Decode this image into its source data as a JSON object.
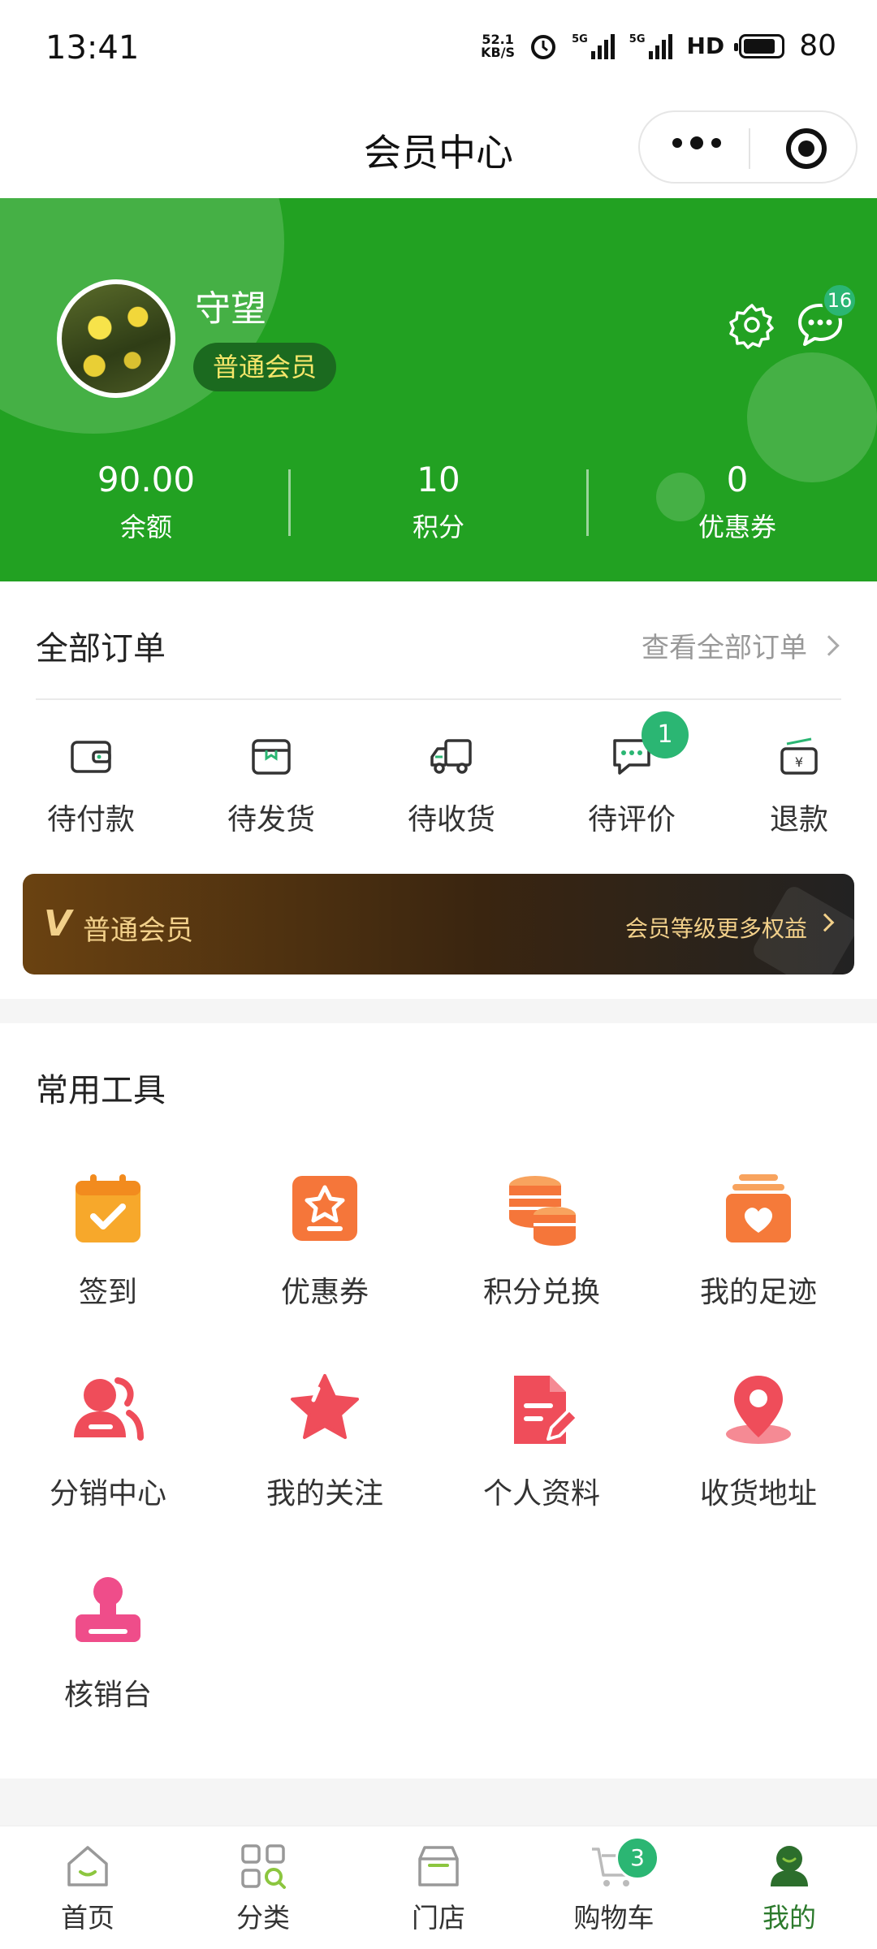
{
  "status_bar": {
    "time": "13:41",
    "net_speed_value": "52.1",
    "net_speed_unit": "KB/S",
    "network_tag_1": "5G",
    "network_tag_2": "5G",
    "hd": "HD",
    "battery": "80"
  },
  "navbar": {
    "title": "会员中心"
  },
  "profile": {
    "username": "守望",
    "level": "普通会员",
    "message_count": "16"
  },
  "stats": [
    {
      "value": "90.00",
      "label": "余额"
    },
    {
      "value": "10",
      "label": "积分"
    },
    {
      "value": "0",
      "label": "优惠券"
    }
  ],
  "orders": {
    "title": "全部订单",
    "view_all": "查看全部订单",
    "items": [
      {
        "label": "待付款",
        "icon": "wallet-icon"
      },
      {
        "label": "待发货",
        "icon": "package-icon"
      },
      {
        "label": "待收货",
        "icon": "truck-icon"
      },
      {
        "label": "待评价",
        "icon": "comment-icon",
        "badge": "1"
      },
      {
        "label": "退款",
        "icon": "refund-icon"
      }
    ]
  },
  "vip_bar": {
    "v_mark": "V",
    "level": "普通会员",
    "more_text": "会员等级更多权益"
  },
  "tools": {
    "title": "常用工具",
    "items": [
      {
        "label": "签到",
        "icon": "calendar-check-icon",
        "color": "#f7a82b"
      },
      {
        "label": "优惠券",
        "icon": "coupon-star-icon",
        "color": "#f5763a"
      },
      {
        "label": "积分兑换",
        "icon": "coins-icon",
        "color": "#f5763a"
      },
      {
        "label": "我的足迹",
        "icon": "heart-box-icon",
        "color": "#f57a3a"
      },
      {
        "label": "分销中心",
        "icon": "users-icon",
        "color": "#ef4d5a"
      },
      {
        "label": "我的关注",
        "icon": "star-icon",
        "color": "#ef4d5a"
      },
      {
        "label": "个人资料",
        "icon": "edit-doc-icon",
        "color": "#ef4d5a"
      },
      {
        "label": "收货地址",
        "icon": "location-pin-icon",
        "color": "#ef4d5a"
      },
      {
        "label": "核销台",
        "icon": "stamp-icon",
        "color": "#ef4d8a"
      }
    ]
  },
  "tabbar": {
    "items": [
      {
        "label": "首页",
        "icon": "home-icon"
      },
      {
        "label": "分类",
        "icon": "category-icon"
      },
      {
        "label": "门店",
        "icon": "store-icon"
      },
      {
        "label": "购物车",
        "icon": "cart-icon",
        "badge": "3"
      },
      {
        "label": "我的",
        "icon": "user-icon",
        "active": true
      }
    ]
  },
  "colors": {
    "brand_green": "#22a122",
    "badge_green": "#2bb673",
    "vip_gold": "#f2d08a"
  }
}
